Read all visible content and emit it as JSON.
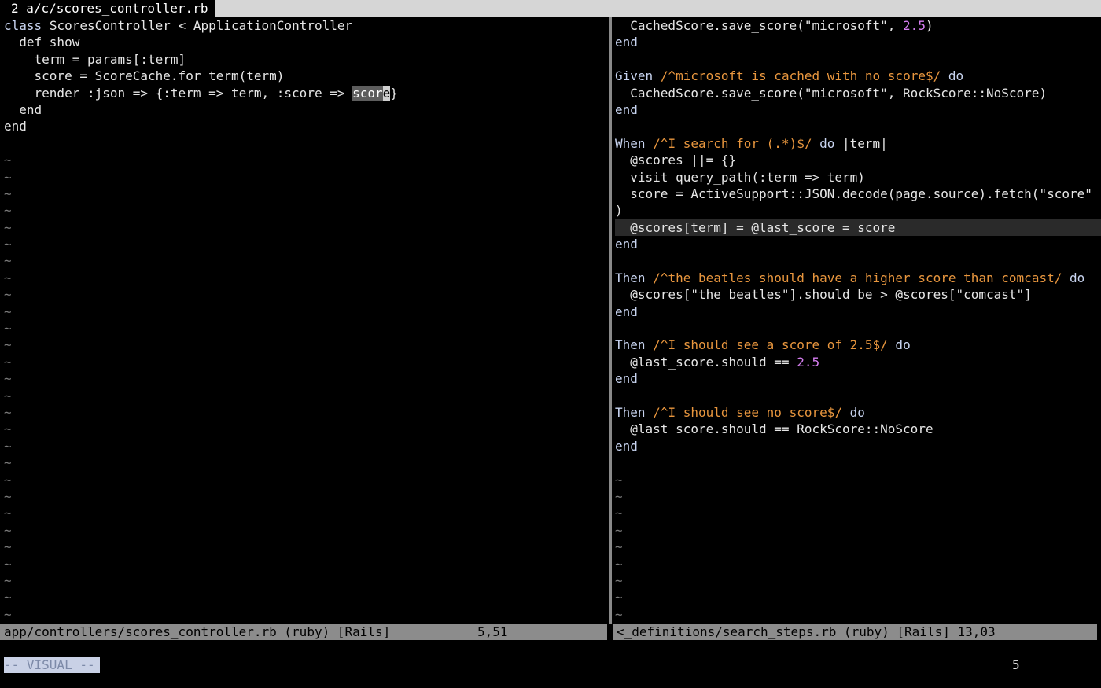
{
  "tabline": {
    "tab_label": "2 a/c/scores_controller.rb"
  },
  "left_pane": {
    "lines": [
      "class ScoresController < ApplicationController",
      "  def show",
      "    term = params[:term]",
      "    score = ScoreCache.for_term(term)",
      "    render :json => {:term => term, :score => ",
      "  end",
      "end"
    ],
    "visual_selection": "scor",
    "cursor_char": "e",
    "after_cursor": "}",
    "tilde": "~",
    "tilde_count": 29
  },
  "right_pane": {
    "lines": [
      "  CachedScore.save_score(\"microsoft\", 2.5)",
      "end",
      "",
      "Given /^microsoft is cached with no score$/ do",
      "  CachedScore.save_score(\"microsoft\", RockScore::NoScore)",
      "end",
      "",
      "When /^I search for (.*)$/ do |term|",
      "  @scores ||= {}",
      "  visit query_path(:term => term)",
      "  score = ActiveSupport::JSON.decode(page.source).fetch(\"score\"",
      ")",
      "  @scores[term] = @last_score = score",
      "end",
      "",
      "Then /^the beatles should have a higher score than comcast/ do",
      "  @scores[\"the beatles\"].should be > @scores[\"comcast\"]",
      "end",
      "",
      "Then /^I should see a score of 2.5$/ do",
      "  @last_score.should == 2.5",
      "end",
      "",
      "Then /^I should see no score$/ do",
      "  @last_score.should == RockScore::NoScore",
      "end",
      ""
    ],
    "tilde": "~",
    "tilde_count": 9
  },
  "status_left": {
    "file": "app/controllers/scores_controller.rb (ruby) [Rails]",
    "position": "5,51"
  },
  "status_right": {
    "file": "<_definitions/search_steps.rb (ruby) [Rails] 13,03"
  },
  "cmdline": {
    "mode": "-- VISUAL --",
    "count": "5"
  },
  "colors": {
    "background": "#000000",
    "keyword": "#c8d4f0",
    "regex": "#e8963e",
    "number": "#d57df0",
    "status_bar": "#8c8c8c"
  }
}
